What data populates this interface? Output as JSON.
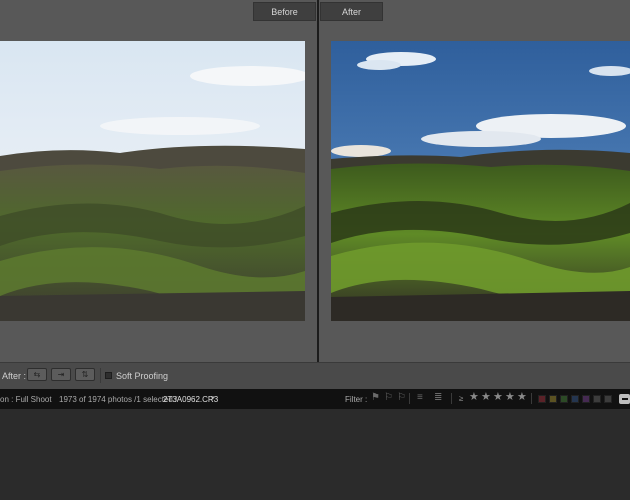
{
  "compare_view": {
    "before_label": "Before",
    "after_label": "After"
  },
  "toolbar": {
    "before_after_label": "After :",
    "swap_buttons": [
      "swap-left-right-icon",
      "copy-settings-icon",
      "swap-settings-icon"
    ],
    "soft_proofing_label": "Soft Proofing",
    "soft_proofing_checked": false
  },
  "filmstrip": {
    "source": "on : Full Shoot",
    "count": "1973 of 1974 photos /1 selected /",
    "filename": "2T3A0962.CR3",
    "filename_arrow": "▾",
    "filter_label": "Filter :",
    "rating_operator": "≥",
    "star_count": 5,
    "color_labels": [
      "#5a2228",
      "#5b5222",
      "#2c4a26",
      "#24354f",
      "#452a52",
      "#3c3c3c",
      "#3c3c3c"
    ]
  }
}
